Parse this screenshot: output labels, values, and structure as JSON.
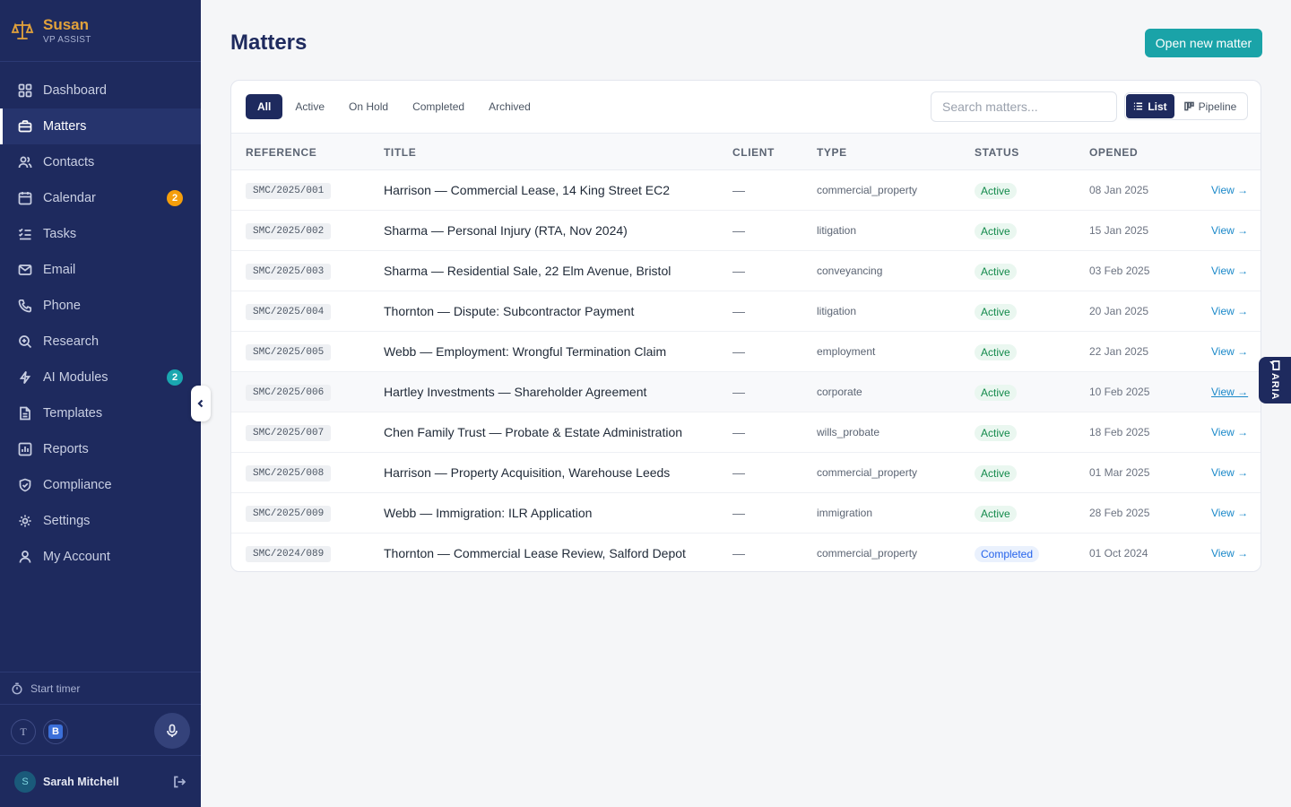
{
  "brand": {
    "name": "Susan",
    "subtitle": "VP ASSIST"
  },
  "sidebar": {
    "items": [
      {
        "label": "Dashboard",
        "icon": "grid-icon"
      },
      {
        "label": "Matters",
        "icon": "briefcase-icon",
        "active": true
      },
      {
        "label": "Contacts",
        "icon": "users-icon"
      },
      {
        "label": "Calendar",
        "icon": "calendar-icon",
        "badge": "2"
      },
      {
        "label": "Tasks",
        "icon": "checklist-icon"
      },
      {
        "label": "Email",
        "icon": "mail-icon"
      },
      {
        "label": "Phone",
        "icon": "phone-icon"
      },
      {
        "label": "Research",
        "icon": "zoom-icon"
      },
      {
        "label": "AI Modules",
        "icon": "lightning-icon",
        "badge": "2"
      },
      {
        "label": "Templates",
        "icon": "document-icon"
      },
      {
        "label": "Reports",
        "icon": "bar-chart-icon"
      },
      {
        "label": "Compliance",
        "icon": "shield-icon"
      },
      {
        "label": "Settings",
        "icon": "gear-icon"
      },
      {
        "label": "My Account",
        "icon": "user-icon"
      }
    ],
    "timer_label": "Start timer",
    "tool_t": "T",
    "tool_b": "B",
    "user": {
      "initial": "S",
      "name": "Sarah Mitchell"
    }
  },
  "page": {
    "title": "Matters",
    "primary_action": "Open new matter"
  },
  "filters": [
    "All",
    "Active",
    "On Hold",
    "Completed",
    "Archived"
  ],
  "search": {
    "placeholder": "Search matters..."
  },
  "view_toggle": {
    "list": "List",
    "pipeline": "Pipeline"
  },
  "table": {
    "columns": [
      "REFERENCE",
      "TITLE",
      "CLIENT",
      "TYPE",
      "STATUS",
      "OPENED"
    ],
    "rows": [
      {
        "ref": "SMC/2025/001",
        "title": "Harrison — Commercial Lease, 14 King Street EC2",
        "client": "—",
        "type": "commercial_property",
        "status": "Active",
        "opened": "08 Jan 2025",
        "action": "View →"
      },
      {
        "ref": "SMC/2025/002",
        "title": "Sharma — Personal Injury (RTA, Nov 2024)",
        "client": "—",
        "type": "litigation",
        "status": "Active",
        "opened": "15 Jan 2025",
        "action": "View →"
      },
      {
        "ref": "SMC/2025/003",
        "title": "Sharma — Residential Sale, 22 Elm Avenue, Bristol",
        "client": "—",
        "type": "conveyancing",
        "status": "Active",
        "opened": "03 Feb 2025",
        "action": "View →"
      },
      {
        "ref": "SMC/2025/004",
        "title": "Thornton — Dispute: Subcontractor Payment",
        "client": "—",
        "type": "litigation",
        "status": "Active",
        "opened": "20 Jan 2025",
        "action": "View →"
      },
      {
        "ref": "SMC/2025/005",
        "title": "Webb — Employment: Wrongful Termination Claim",
        "client": "—",
        "type": "employment",
        "status": "Active",
        "opened": "22 Jan 2025",
        "action": "View →"
      },
      {
        "ref": "SMC/2025/006",
        "title": "Hartley Investments — Shareholder Agreement",
        "client": "—",
        "type": "corporate",
        "status": "Active",
        "opened": "10 Feb 2025",
        "action": "View →"
      },
      {
        "ref": "SMC/2025/007",
        "title": "Chen Family Trust — Probate & Estate Administration",
        "client": "—",
        "type": "wills_probate",
        "status": "Active",
        "opened": "18 Feb 2025",
        "action": "View →"
      },
      {
        "ref": "SMC/2025/008",
        "title": "Harrison — Property Acquisition, Warehouse Leeds",
        "client": "—",
        "type": "commercial_property",
        "status": "Active",
        "opened": "01 Mar 2025",
        "action": "View →"
      },
      {
        "ref": "SMC/2025/009",
        "title": "Webb — Immigration: ILR Application",
        "client": "—",
        "type": "immigration",
        "status": "Active",
        "opened": "28 Feb 2025",
        "action": "View →"
      },
      {
        "ref": "SMC/2024/089",
        "title": "Thornton — Commercial Lease Review, Salford Depot",
        "client": "—",
        "type": "commercial_property",
        "status": "Completed",
        "opened": "01 Oct 2024",
        "action": "View →"
      }
    ]
  },
  "aria_tab": "ARIA",
  "colors": {
    "sidebar": "#1e2a5e",
    "accent": "#1aa3a8",
    "brand": "#e2a23b",
    "active_status": "#138a4b",
    "completed_status": "#2563eb"
  }
}
